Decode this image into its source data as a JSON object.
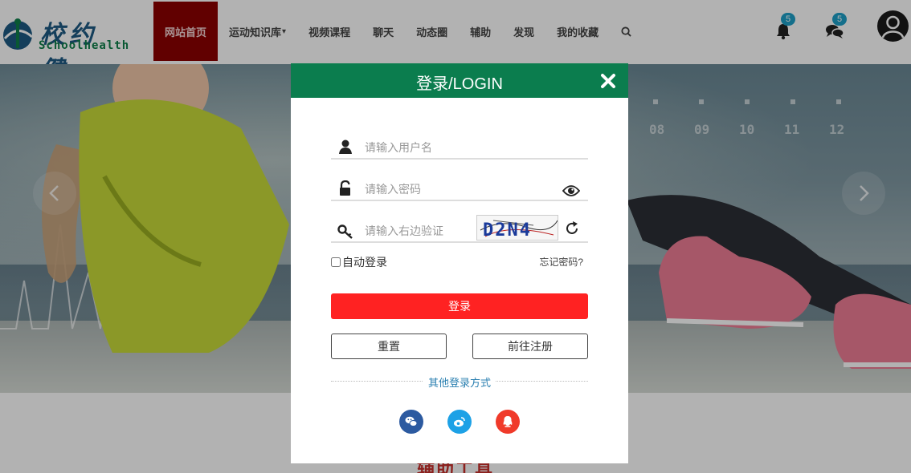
{
  "brand": {
    "name_cn": "校约健",
    "name_en": "Schoolhealth"
  },
  "nav": {
    "items": [
      {
        "label": "网站首页",
        "active": true
      },
      {
        "label": "运动知识库",
        "dropdown": true
      },
      {
        "label": "视频课程"
      },
      {
        "label": "聊天"
      },
      {
        "label": "动态圈"
      },
      {
        "label": "辅助"
      },
      {
        "label": "发现"
      },
      {
        "label": "我的收藏"
      }
    ],
    "dropdown_caret": "▾",
    "search_icon": "search-icon"
  },
  "header_actions": {
    "notifications_count": "5",
    "messages_count": "5"
  },
  "banner": {
    "numbers": [
      "08",
      "09",
      "10",
      "11",
      "12"
    ]
  },
  "section_title": "辅助工具",
  "login_modal": {
    "title": "登录/LOGIN",
    "username_placeholder": "请输入用户名",
    "password_placeholder": "请输入密码",
    "captcha_placeholder": "请输入右边验证",
    "captcha_text": "D2N4",
    "remember_label": "自动登录",
    "forgot_label": "忘记密码?",
    "login_button": "登录",
    "reset_button": "重置",
    "register_button": "前往注册",
    "other_login_label": "其他登录方式",
    "social": [
      {
        "name": "wechat",
        "color": "#2c5aa0"
      },
      {
        "name": "weibo",
        "color": "#1da1e6"
      },
      {
        "name": "qq",
        "color": "#f03a2a"
      }
    ]
  },
  "colors": {
    "modal_header": "#0b7d4e",
    "nav_active": "#8b0000",
    "login_button": "#ff2222",
    "badge": "#1ea0c8",
    "link": "#2a7fb0"
  }
}
